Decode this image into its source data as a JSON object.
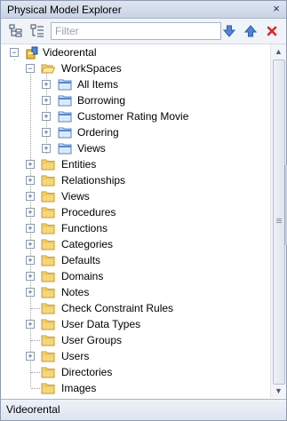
{
  "panel": {
    "title": "Physical Model Explorer",
    "close_label": "×"
  },
  "toolbar": {
    "filter_placeholder": "Filter",
    "tool1_icon": "expand-tree-icon",
    "tool2_icon": "collapse-tree-icon",
    "down_icon": "arrow-down-icon",
    "up_icon": "arrow-up-icon",
    "delete_icon": "delete-x-icon"
  },
  "tree": {
    "root": "Videorental",
    "workspaces": {
      "label": "WorkSpaces",
      "children": [
        "All Items",
        "Borrowing",
        "Customer Rating Movie",
        "Ordering",
        "Views"
      ]
    },
    "folders": [
      {
        "label": "Entities",
        "expandable": true
      },
      {
        "label": "Relationships",
        "expandable": true
      },
      {
        "label": "Views",
        "expandable": true
      },
      {
        "label": "Procedures",
        "expandable": true
      },
      {
        "label": "Functions",
        "expandable": true
      },
      {
        "label": "Categories",
        "expandable": true
      },
      {
        "label": "Defaults",
        "expandable": true
      },
      {
        "label": "Domains",
        "expandable": true
      },
      {
        "label": "Notes",
        "expandable": true
      },
      {
        "label": "Check Constraint Rules",
        "expandable": false
      },
      {
        "label": "User Data Types",
        "expandable": true
      },
      {
        "label": "User Groups",
        "expandable": false
      },
      {
        "label": "Users",
        "expandable": true
      },
      {
        "label": "Directories",
        "expandable": false
      },
      {
        "label": "Images",
        "expandable": false
      }
    ]
  },
  "statusbar": {
    "text": "Videorental"
  },
  "colors": {
    "folder": "#f5d77a",
    "folder_border": "#c99a2e",
    "accent": "#3b73c8",
    "delete": "#d9262b"
  }
}
